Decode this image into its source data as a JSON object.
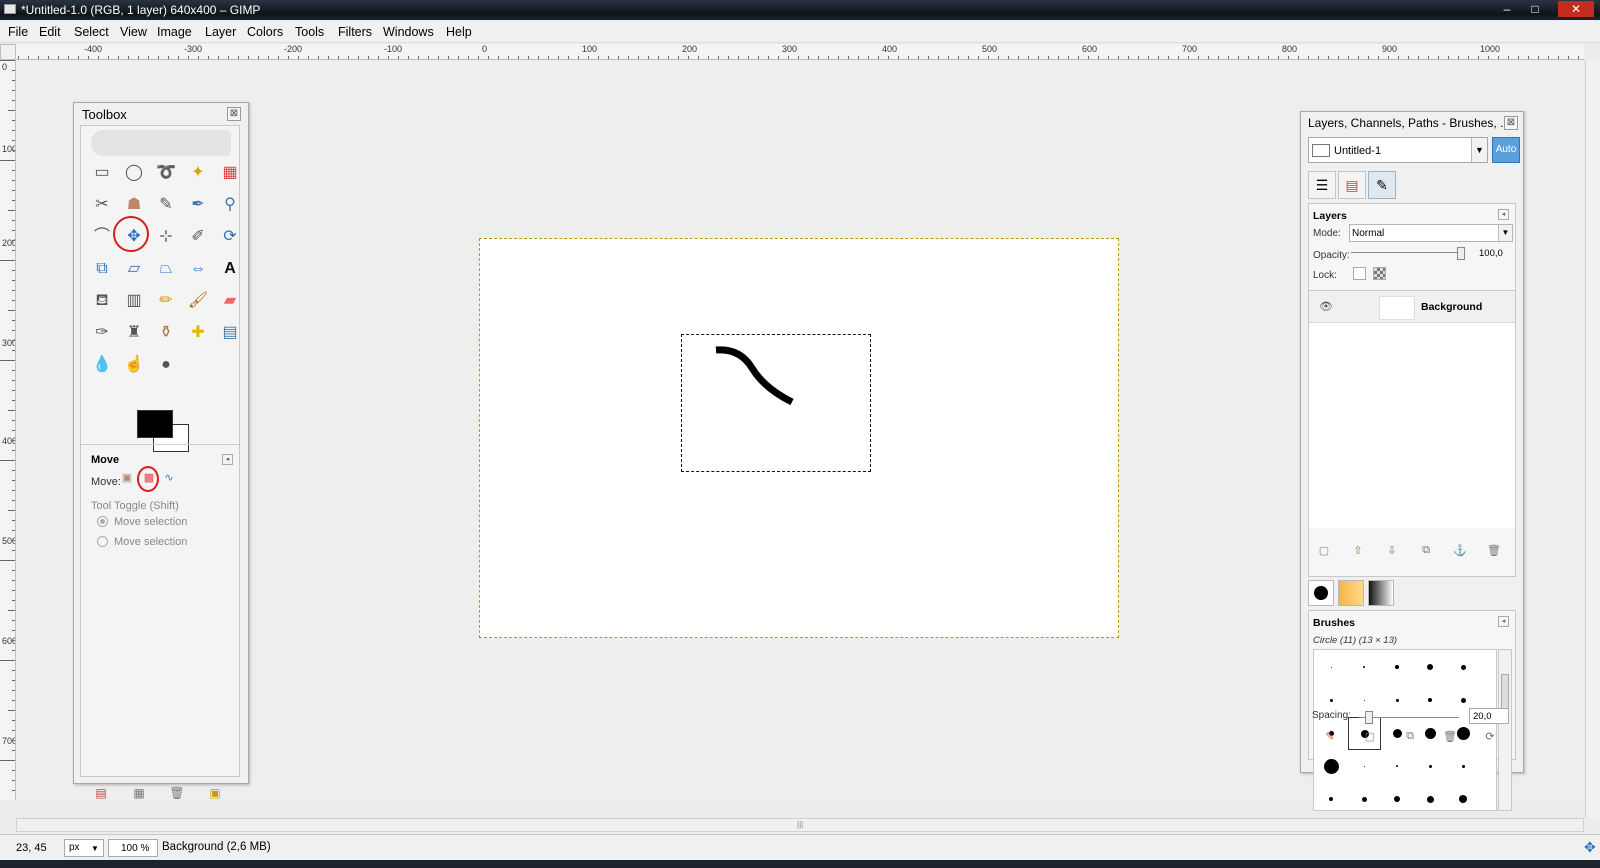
{
  "window": {
    "title": "*Untitled-1.0 (RGB, 1 layer) 640x400 – GIMP",
    "minimize": "–",
    "maximize": "□",
    "close": "✕"
  },
  "menu": [
    "File",
    "Edit",
    "Select",
    "View",
    "Image",
    "Layer",
    "Colors",
    "Tools",
    "Filters",
    "Windows",
    "Help"
  ],
  "ruler": {
    "h_labels": [
      "-400",
      "-300",
      "-200",
      "-100",
      "0",
      "100",
      "200",
      "300",
      "400",
      "500",
      "600",
      "700",
      "800",
      "900",
      "1000"
    ],
    "v_labels": [
      "0",
      "100",
      "200",
      "300",
      "400",
      "500",
      "600",
      "700"
    ]
  },
  "toolbox": {
    "title": "Toolbox",
    "close": "⊠",
    "options_title": "Move",
    "move_label": "Move:",
    "tool_toggle": "Tool Toggle  (Shift)",
    "radio1": "Move selection",
    "radio2": "Move selection",
    "tools": [
      "rect-select",
      "ellipse-select",
      "free-select",
      "fuzzy-select",
      "select-by-color",
      "scissors",
      "foreground-select",
      "paths",
      "color-picker",
      "zoom",
      "measure",
      "move",
      "align",
      "crop",
      "rotate",
      "scale",
      "shear",
      "perspective",
      "flip",
      "text",
      "bucket-fill",
      "blend",
      "pencil",
      "paintbrush",
      "eraser",
      "airbrush",
      "ink",
      "clone",
      "heal",
      "perspective-clone",
      "blur",
      "smudge",
      "dodge-burn"
    ]
  },
  "dock": {
    "title": "Layers, Channels, Paths - Brushes, ...",
    "close": "⊠",
    "image_select": "Untitled-1",
    "auto": "Auto",
    "layers_title": "Layers",
    "mode_label": "Mode:",
    "mode_value": "Normal",
    "opacity_label": "Opacity:",
    "opacity_value": "100,0",
    "lock_label": "Lock:",
    "layer_name": "Background",
    "brushes_title": "Brushes",
    "brush_name": "Circle (11) (13 × 13)",
    "spacing_label": "Spacing:",
    "spacing_value": "20,0"
  },
  "status": {
    "coords": "23, 45",
    "unit": "px",
    "zoom": "100 %",
    "message": "Background (2,6 MB)"
  }
}
